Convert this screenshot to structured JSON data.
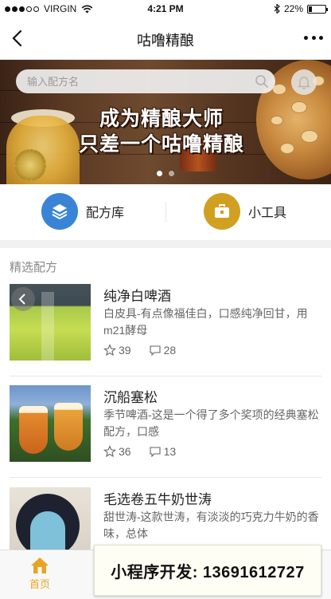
{
  "status_bar": {
    "carrier": "VIRGIN",
    "time": "4:21 PM",
    "battery_percent": "22%",
    "battery_level": 0.22,
    "signal_bars_filled": 3,
    "signal_bars_total": 5
  },
  "nav": {
    "title": "咕噜精酿",
    "back_icon": "chevron-left-icon",
    "more_icon": "ellipsis-icon"
  },
  "banner": {
    "search_placeholder": "输入配方名",
    "headline_line1": "成为精酿大师",
    "headline_line2": "只差一个咕噜精酿",
    "page_count": 2,
    "active_page": 1
  },
  "quick_entries": [
    {
      "label": "配方库",
      "icon": "layers-icon",
      "color": "#3a84d6"
    },
    {
      "label": "小工具",
      "icon": "toolbox-icon",
      "color": "#d1a021"
    }
  ],
  "section": {
    "title": "精选配方"
  },
  "recipes": [
    {
      "title": "纯净白啤酒",
      "description": "白皮具-有点像福佳白，口感纯净回甘，用m21酵母",
      "stars": "39",
      "comments": "28"
    },
    {
      "title": "沉船塞松",
      "description": "季节啤酒-这是一个得了多个奖项的经典塞松配方，口感",
      "stars": "36",
      "comments": "13"
    },
    {
      "title": "毛选卷五牛奶世涛",
      "description": "甜世涛-这款世涛，有淡淡的巧克力牛奶的香味，总体",
      "stars": "",
      "comments": ""
    }
  ],
  "tabbar": {
    "home_label": "首页",
    "home_icon": "home-icon",
    "active_color": "#e8a324"
  },
  "promo": {
    "text": "小程序开发: 13691612727"
  }
}
